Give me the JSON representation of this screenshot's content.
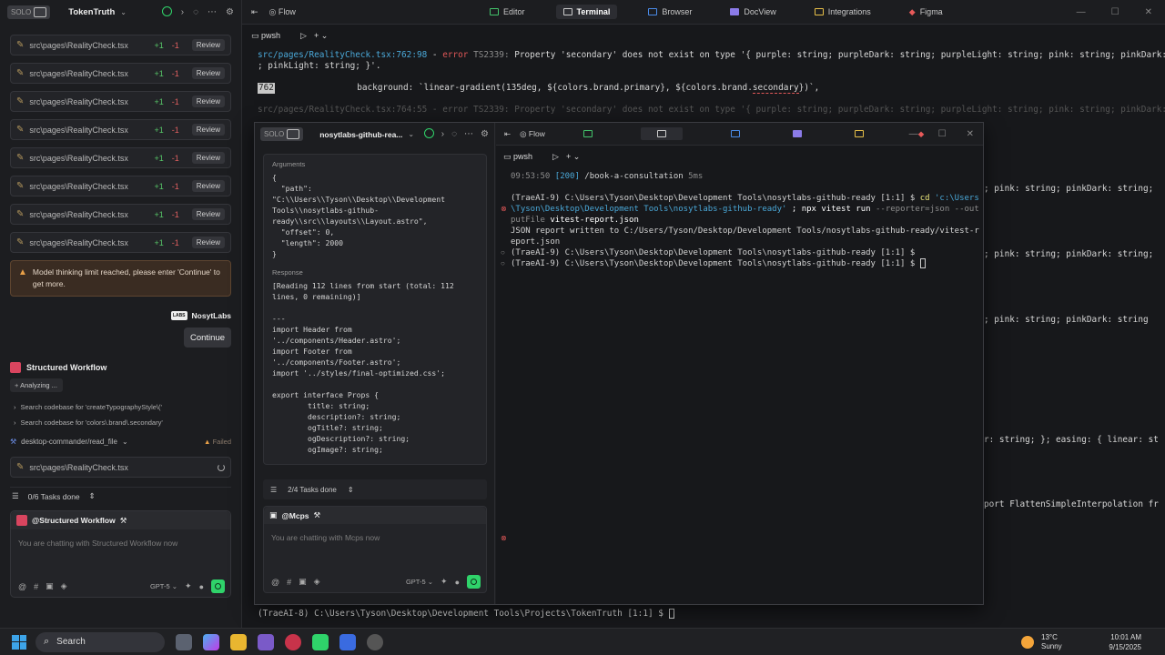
{
  "left_panel": {
    "solo_label": "SOLO",
    "workspace": "TokenTruth",
    "files": [
      {
        "name": "src\\pages\\RealityCheck.tsx",
        "plus": "+1",
        "minus": "-1",
        "action": "Review"
      },
      {
        "name": "src\\pages\\RealityCheck.tsx",
        "plus": "+1",
        "minus": "-1",
        "action": "Review"
      },
      {
        "name": "src\\pages\\RealityCheck.tsx",
        "plus": "+1",
        "minus": "-1",
        "action": "Review"
      },
      {
        "name": "src\\pages\\RealityCheck.tsx",
        "plus": "+1",
        "minus": "-1",
        "action": "Review"
      },
      {
        "name": "src\\pages\\RealityCheck.tsx",
        "plus": "+1",
        "minus": "-1",
        "action": "Review"
      },
      {
        "name": "src\\pages\\RealityCheck.tsx",
        "plus": "+1",
        "minus": "-1",
        "action": "Review"
      },
      {
        "name": "src\\pages\\RealityCheck.tsx",
        "plus": "+1",
        "minus": "-1",
        "action": "Review"
      },
      {
        "name": "src\\pages\\RealityCheck.tsx",
        "plus": "+1",
        "minus": "-1",
        "action": "Review"
      }
    ],
    "warning": "Model thinking limit reached, please enter 'Continue' to get more.",
    "brand": "NosytLabs",
    "brand_logo": "LABS",
    "continue_label": "Continue",
    "workflow_title": "Structured Workflow",
    "analyzing": "Analyzing ...",
    "search1": "Search codebase for 'createTypographyStyle\\('",
    "search2": "Search codebase for 'colors\\.brand\\.secondary'",
    "tool": "desktop-commander/read_file",
    "tool_status": "Failed",
    "loading_file": "src\\pages\\RealityCheck.tsx",
    "tasks": "0/6 Tasks done",
    "chat_agent": "@Structured Workflow",
    "chat_placeholder": "You are chatting with Structured Workflow now",
    "model": "GPT-5"
  },
  "main": {
    "flow_label": "Flow",
    "tabs": [
      "Editor",
      "Terminal",
      "Browser",
      "DocView",
      "Integrations",
      "Figma"
    ],
    "active_tab": "Terminal",
    "term_title": "pwsh",
    "err_path": "src/pages/RealityCheck.tsx:762:98",
    "err_sep": " - ",
    "err_word": "error",
    "err_code": " TS2339: ",
    "err_msg": "Property 'secondary' does not exist on type '{ purple: string; purpleDark: string; purpleLight: string; pink: string; pinkDark: string",
    "err_msg2": "; pinkLight: string; }'.",
    "line_no": "762",
    "bg_code": "                background: `linear-gradient(135deg, ${colors.brand.primary}, ${colors.brand.",
    "bg_squiggle": "secondary",
    "bg_end": "})`,",
    "partial_error": "src/pages/RealityCheck.tsx:764:55 - error TS2339: Property 'secondary' does not exist on type '{ purple: string; purpleDark: string; purpleLight: string; pink: string; pinkDark: string;",
    "frag1": "; pink: string; pinkDark: string;",
    "frag2": "; pink: string; pinkDark: string",
    "frag3": "; pink: string; pinkDark: string",
    "frag4": "r: string; }; easing: { linear: st",
    "frag5": "port FlattenSimpleInterpolation fr",
    "frag6": "(TraeAI-8) C:\\Users\\Tyson\\Desktop\\Development Tools\\Projects\\TokenTruth [1:1] $ ",
    "frag6b": "[ ] [ ]"
  },
  "float": {
    "solo_label": "SOLO",
    "workspace": "nosytlabs-github-rea...",
    "args_label": "Arguments",
    "args": "{\n  \"path\":\n\"C:\\\\Users\\\\Tyson\\\\Desktop\\\\Development\nTools\\\\nosytlabs-github-\nready\\\\src\\\\layouts\\\\Layout.astro\",\n  \"offset\": 0,\n  \"length\": 2000\n}",
    "resp_label": "Response",
    "response": "[Reading 112 lines from start (total: 112\nlines, 0 remaining)]\n\n---\nimport Header from\n'../components/Header.astro';\nimport Footer from\n'../components/Footer.astro';\nimport '../styles/final-optimized.css';\n\nexport interface Props {\n        title: string;\n        description?: string;\n        ogTitle?: string;\n        ogDescription?: string;\n        ogImage?: string;",
    "tasks": "2/4 Tasks done",
    "chat_agent": "@Mcps",
    "chat_placeholder": "You are chatting with Mcps now",
    "model": "GPT-5",
    "flow_label": "Flow",
    "term_title": "pwsh",
    "log_time": "09:53:50",
    "log_code": "[200]",
    "log_path": " /book-a-consultation ",
    "log_ms": "5ms",
    "prompt1": "(TraeAI-9) C:\\Users\\Tyson\\Desktop\\Development Tools\\nosytlabs-github-ready [1:1] $ ",
    "cd": "cd",
    "cd_arg1": " 'c:\\Users",
    "cd_arg2": "\\Tyson\\Desktop\\Development Tools\\nosytlabs-github-ready'",
    "cmd_rest": " ; npx vitest run ",
    "cmd_flag": "--reporter=json --out",
    "cmd_flag2": "putFile",
    "cmd_file": " vitest-report.json",
    "json_out1": "JSON report written to C:/Users/Tyson/Desktop/Development Tools/nosytlabs-github-ready/vitest-r",
    "json_out2": "eport.json",
    "prompt2": "(TraeAI-9) C:\\Users\\Tyson\\Desktop\\Development Tools\\nosytlabs-github-ready [1:1] $",
    "prompt3": "(TraeAI-9) C:\\Users\\Tyson\\Desktop\\Development Tools\\nosytlabs-github-ready [1:1] $ "
  },
  "taskbar": {
    "search": "Search",
    "temp": "13°C",
    "weather": "Sunny",
    "time": "10:01 AM",
    "date": "9/15/2025"
  }
}
